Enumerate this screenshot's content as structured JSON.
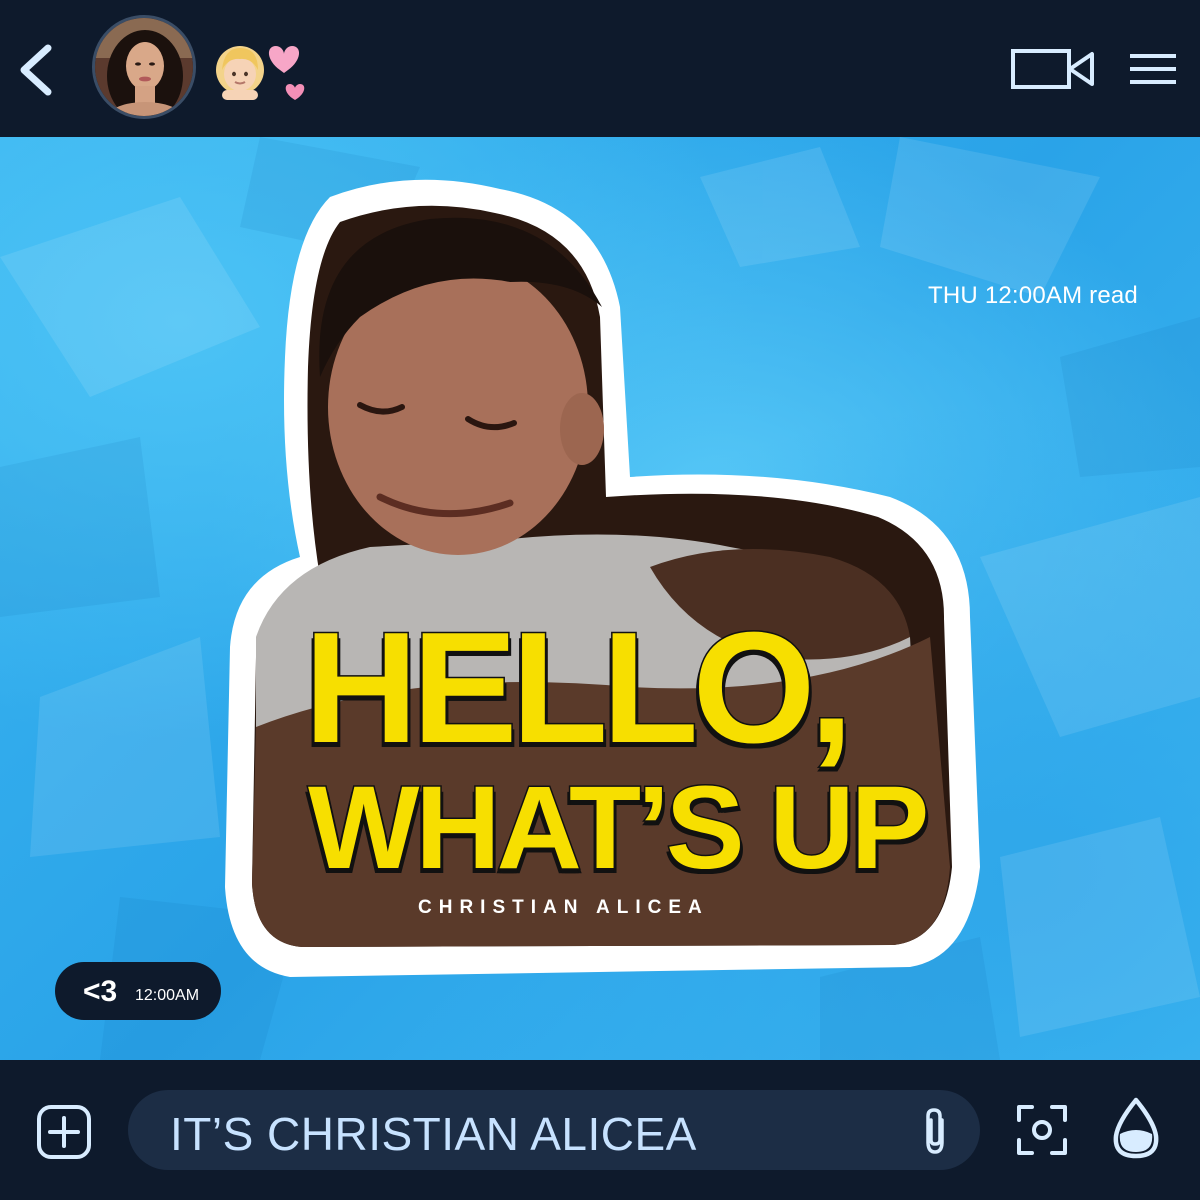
{
  "header": {
    "back_icon": "chevron-left-icon",
    "avatar_icon": "contact-avatar",
    "emoji_icons": [
      "person-emoji-icon",
      "two-hearts-emoji-icon"
    ],
    "video_icon": "video-camera-icon",
    "menu_icon": "hamburger-menu-icon"
  },
  "message": {
    "read_receipt": "THU 12:00AM read",
    "sticker": {
      "title_line1": "HELLO,",
      "title_line2": "WHAT’S UP",
      "artist": "CHRISTIAN ALICEA"
    },
    "reply": {
      "text": "<3",
      "time": "12:00AM"
    }
  },
  "composer": {
    "add_icon": "plus-circle-icon",
    "input_value": "IT’S CHRISTIAN ALICEA",
    "attach_icon": "paperclip-icon",
    "camera_icon": "camera-scan-icon",
    "drop_icon": "water-drop-icon"
  },
  "colors": {
    "bar_background": "#0e1a2c",
    "chat_background": "#34b0ee",
    "title_yellow": "#f7df00",
    "input_background": "#1c2d45",
    "input_text": "#c7e2ff"
  }
}
